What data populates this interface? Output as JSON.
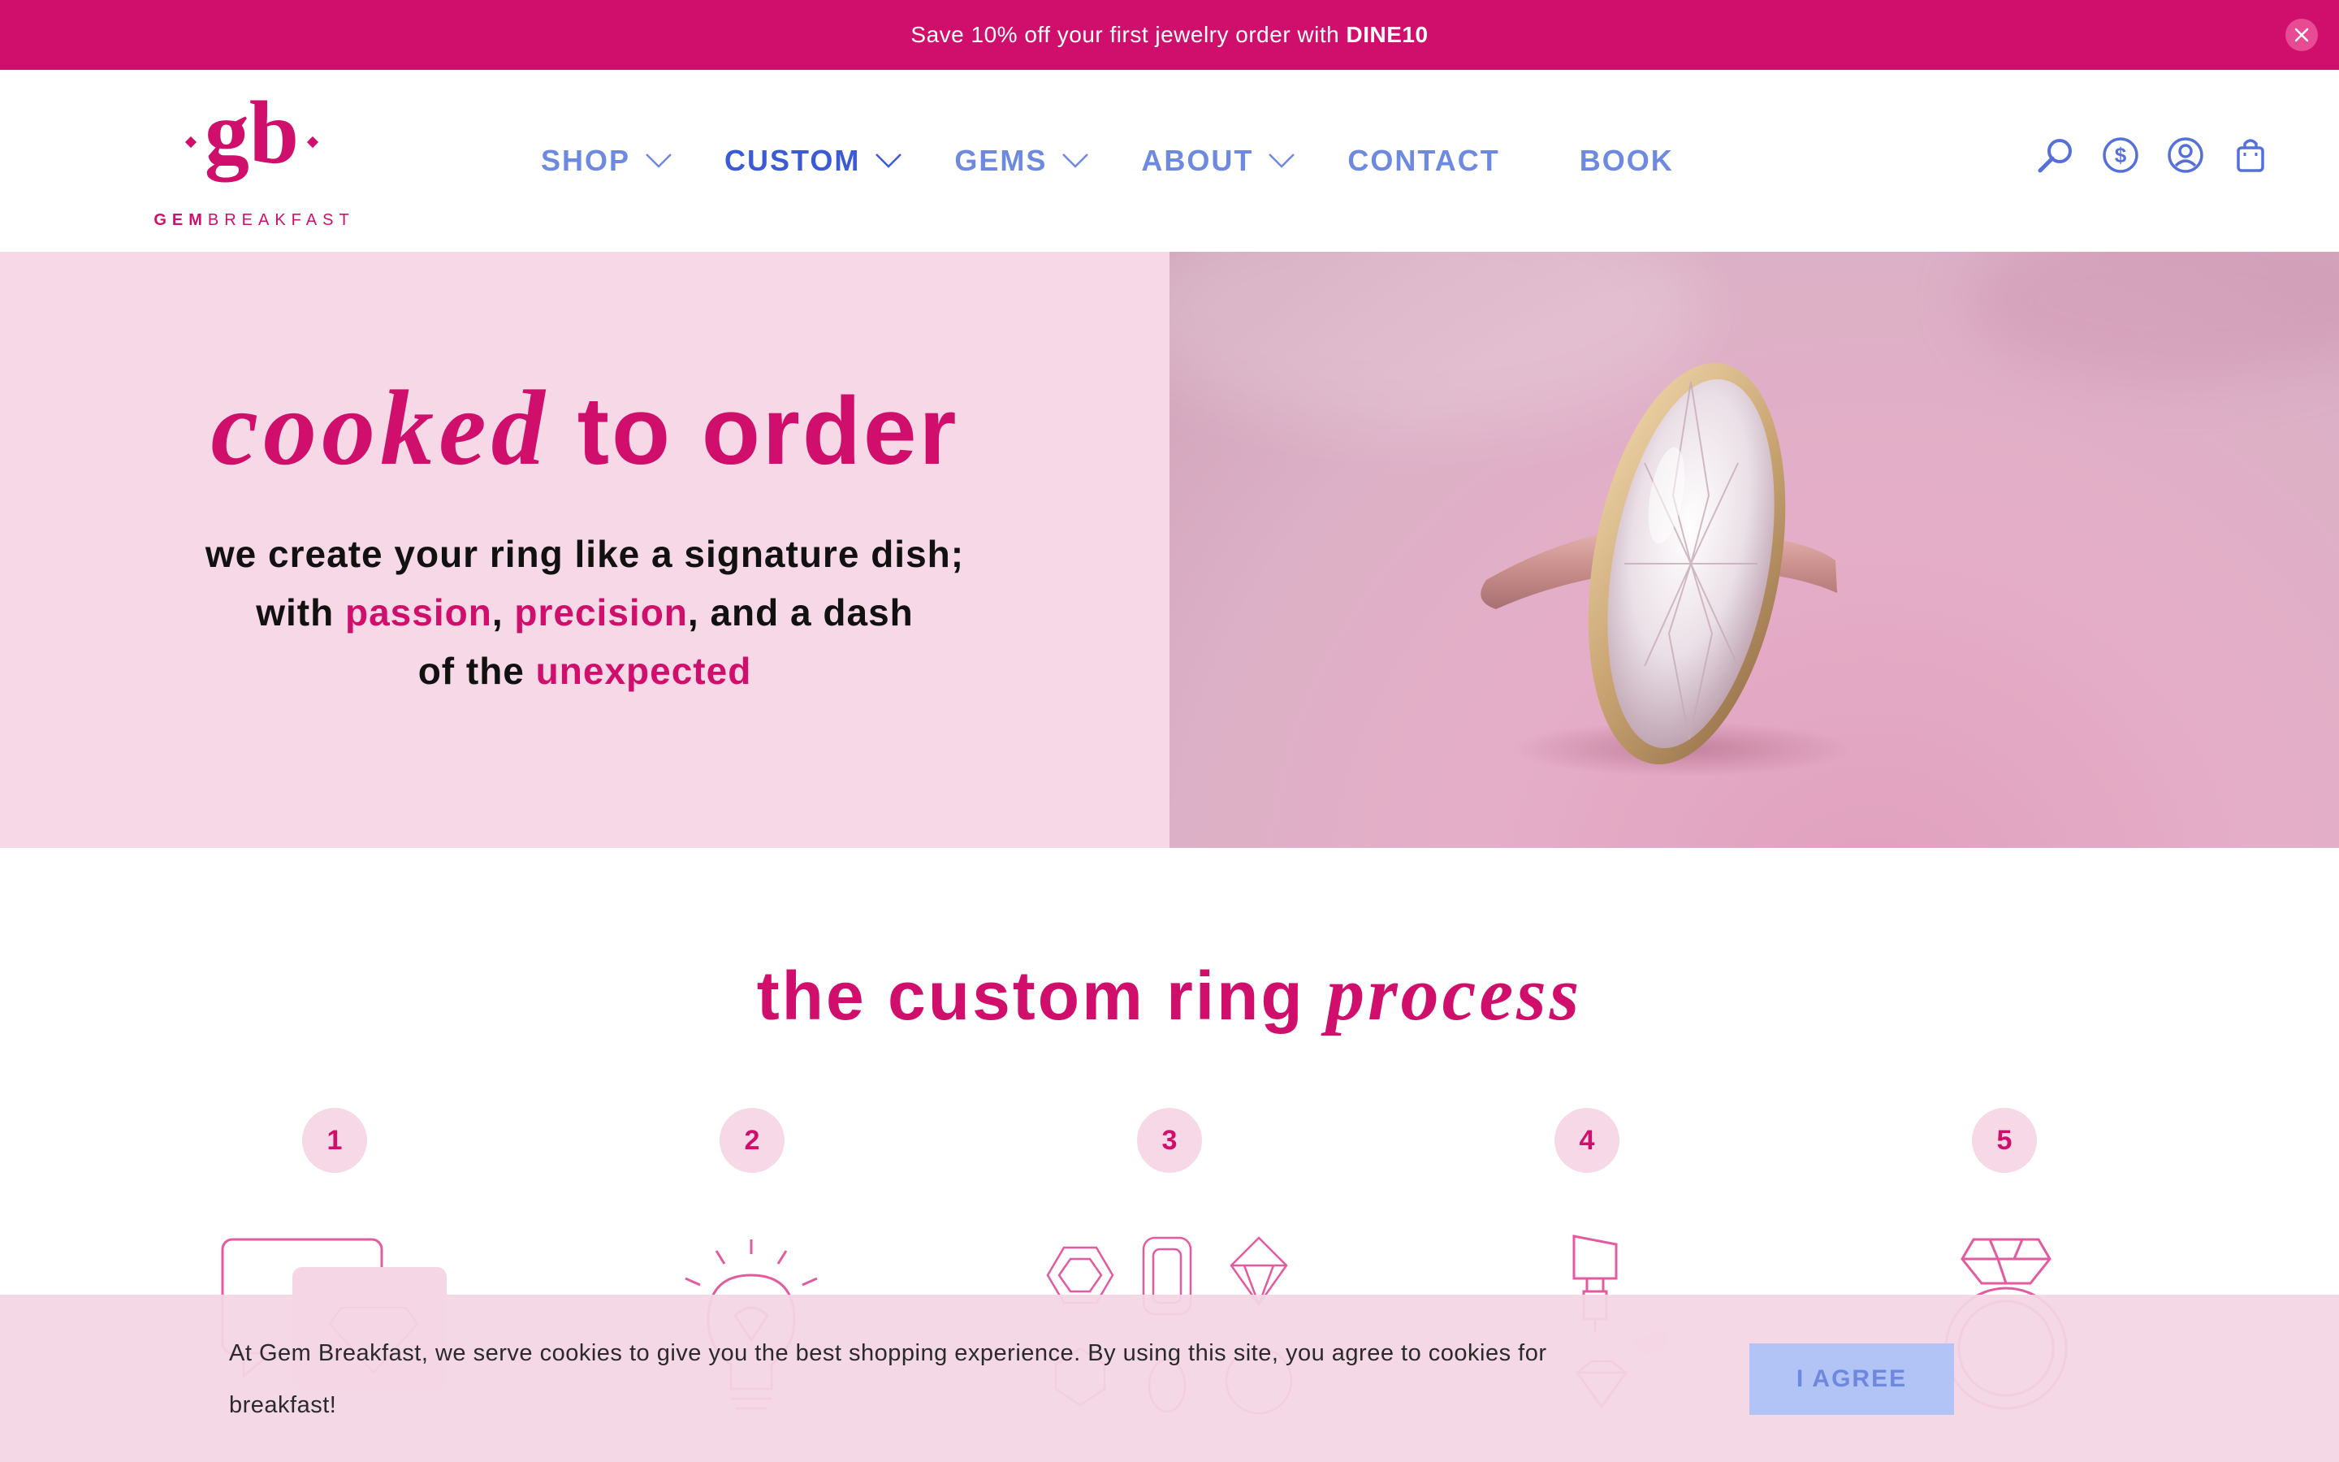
{
  "promo": {
    "text_prefix": "Save 10% off your first jewelry order with ",
    "code": "DINE10",
    "close_icon": "close-icon",
    "bg_color": "#cf0f6b"
  },
  "header": {
    "logo": {
      "mark": "gb",
      "text_part1": "GEM",
      "text_part2": "BREAKFAST"
    },
    "nav": [
      {
        "label": "SHOP",
        "has_dropdown": true
      },
      {
        "label": "CUSTOM",
        "has_dropdown": true,
        "active": true
      },
      {
        "label": "GEMS",
        "has_dropdown": true
      },
      {
        "label": "ABOUT",
        "has_dropdown": true
      },
      {
        "label": "CONTACT",
        "has_dropdown": false
      },
      {
        "label": "BOOK",
        "has_dropdown": false
      }
    ],
    "icons": [
      "search-icon",
      "currency-icon",
      "account-icon",
      "cart-icon"
    ],
    "nav_color": "#6e89e0"
  },
  "hero": {
    "title_italic": "cooked",
    "title_rest": "to order",
    "line1": "we create your ring like a signature dish;",
    "line2_prefix": "with ",
    "word_passion": "passion",
    "comma1": ",",
    "word_precision": "precision",
    "line2_suffix": ", and a dash",
    "line3_prefix": "of the ",
    "word_unexpected": "unexpected",
    "image": "ring-photo",
    "bg_color": "#f6d8e6"
  },
  "process": {
    "title_prefix": "the custom ring ",
    "title_italic": "process",
    "steps": [
      "1",
      "2",
      "3",
      "4",
      "5"
    ],
    "step_icons": [
      "chat-bubbles-icon",
      "lightbulb-icon",
      "gem-shapes-icon",
      "setting-icon",
      "ring-icon"
    ]
  },
  "cookie": {
    "text": "At Gem Breakfast, we serve cookies to give you the best shopping experience. By using this site, you agree to cookies for breakfast!",
    "button_label": "I AGREE"
  }
}
